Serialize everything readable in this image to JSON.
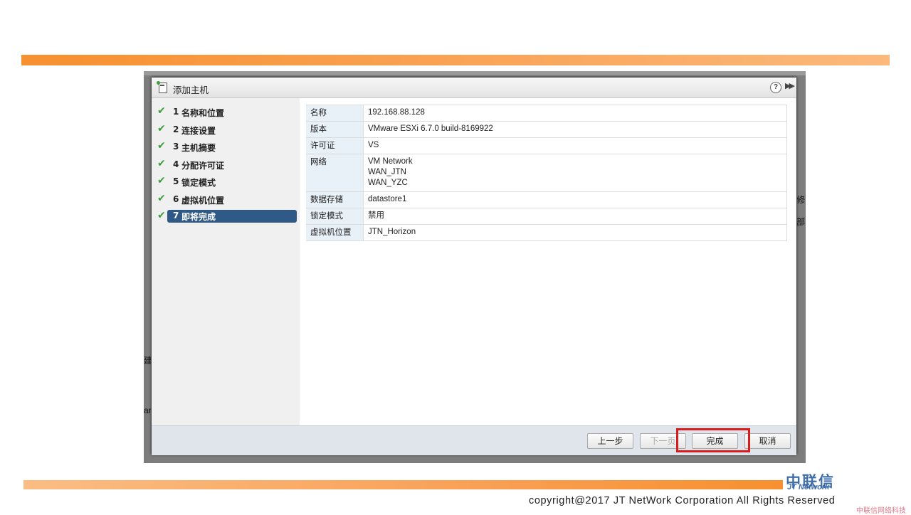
{
  "dialog": {
    "title": "添加主机",
    "help_icon": "?",
    "expand_icon": "▶▶"
  },
  "steps": [
    {
      "num": "1",
      "label": "名称和位置"
    },
    {
      "num": "2",
      "label": "连接设置"
    },
    {
      "num": "3",
      "label": "主机摘要"
    },
    {
      "num": "4",
      "label": "分配许可证"
    },
    {
      "num": "5",
      "label": "锁定模式"
    },
    {
      "num": "6",
      "label": "虚拟机位置"
    },
    {
      "num": "7",
      "label": "即将完成"
    }
  ],
  "check_mark": "✔",
  "summary": {
    "name_key": "名称",
    "name_val": "192.168.88.128",
    "version_key": "版本",
    "version_val": "VMware ESXi 6.7.0 build-8169922",
    "license_key": "许可证",
    "license_val": "VS",
    "network_key": "网络",
    "network_vals": [
      "VM Network",
      "WAN_JTN",
      "WAN_YZC"
    ],
    "datastore_key": "数据存储",
    "datastore_val": "datastore1",
    "lockdown_key": "锁定模式",
    "lockdown_val": "禁用",
    "vmloc_key": "虚拟机位置",
    "vmloc_val": "JTN_Horizon"
  },
  "footer": {
    "back": "上一步",
    "next": "下一页",
    "finish": "完成",
    "cancel": "取消"
  },
  "background_fragments": {
    "right_top": "修",
    "right_mid": "部",
    "left_a": "建",
    "left_b": "ar"
  },
  "slide": {
    "copyright": "copyright@2017  JT NetWork Corporation All Rights Reserved",
    "logo_cn": "中联信",
    "logo_en": "JT Network",
    "watermark": "中联信网络科技"
  },
  "colors": {
    "accent_orange": "#f7902f",
    "active_step": "#2f5a88",
    "highlight_red": "#d81c1c",
    "check_green": "#3c9d3c"
  }
}
